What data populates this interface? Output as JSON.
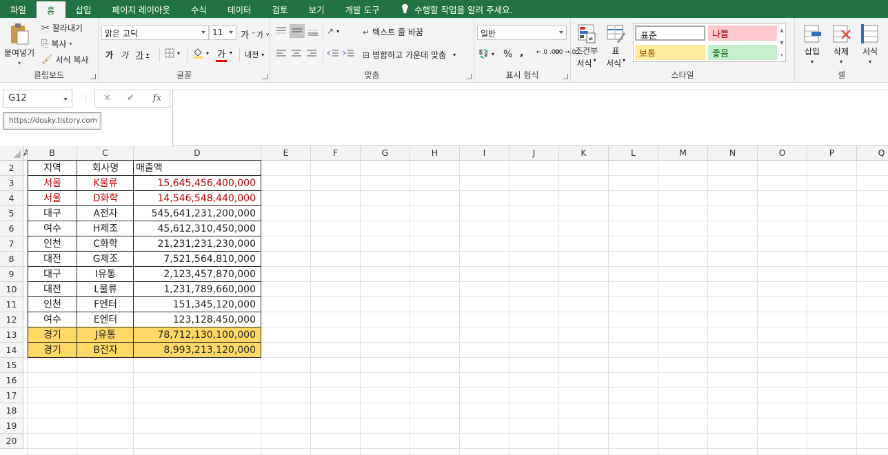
{
  "tabs": [
    "파일",
    "홈",
    "삽입",
    "페이지 레이아웃",
    "수식",
    "데이터",
    "검토",
    "보기",
    "개발 도구"
  ],
  "tell_me": "수행할 작업을 알려 주세요.",
  "ribbon": {
    "clipboard": {
      "paste": "붙여넣기",
      "cut": "잘라내기",
      "copy": "복사",
      "format_painter": "서식 복사",
      "label": "클립보드"
    },
    "font": {
      "name": "맑은 고딕",
      "size": "11",
      "grow": "가",
      "shrink": "가",
      "bold": "가",
      "italic": "가",
      "underline": "가",
      "font_color_glyph": "가",
      "phonetic": "내천",
      "label": "글꼴"
    },
    "align": {
      "wrap": "텍스트 줄 바꿈",
      "merge": "병합하고 가운데 맞춤",
      "label": "맞춤"
    },
    "number": {
      "format": "일반",
      "percent": "%",
      "comma": ",",
      "inc_dec": "←.0 .00",
      "dec_dec": ".00 →.0",
      "label": "표시 형식"
    },
    "cond": {
      "cond_fmt_1": "조건부",
      "cond_fmt_2": "서식",
      "table_1": "표",
      "table_2": "서식"
    },
    "styles": {
      "normal": "표준",
      "bad": "나쁨",
      "neutral": "보통",
      "good": "좋음",
      "label": "스타일",
      "colors": {
        "bad_bg": "#ffc7ce",
        "bad_fg": "#9c0006",
        "neutral_bg": "#ffeb9c",
        "neutral_fg": "#9c5700",
        "good_bg": "#c6efce",
        "good_fg": "#006100"
      }
    },
    "cells": {
      "insert": "삽입",
      "delete": "삭제",
      "format": "서식",
      "label": "셀"
    }
  },
  "formula_bar": {
    "name_box": "G12",
    "cancel": "✕",
    "enter": "✔",
    "fx": "fx",
    "value": ""
  },
  "tooltip": "https://dosky.tistory.com",
  "columns": [
    "A",
    "B",
    "C",
    "D",
    "E",
    "F",
    "G",
    "H",
    "I",
    "J",
    "K",
    "L",
    "M",
    "N",
    "O",
    "P",
    "Q"
  ],
  "rows": [
    "2",
    "3",
    "4",
    "5",
    "6",
    "7",
    "8",
    "9",
    "10",
    "11",
    "12",
    "13",
    "14",
    "15",
    "16",
    "17",
    "18",
    "19",
    "20"
  ],
  "table": {
    "header": [
      "지역",
      "회사명",
      "매출액"
    ],
    "rows": [
      {
        "region": "서울",
        "company": "K물류",
        "sales": "15,645,456,400,000",
        "style": "red"
      },
      {
        "region": "서울",
        "company": "D화학",
        "sales": "14,546,548,440,000",
        "style": "red"
      },
      {
        "region": "대구",
        "company": "A전자",
        "sales": "545,641,231,200,000",
        "style": "normal"
      },
      {
        "region": "여수",
        "company": "H제조",
        "sales": "45,612,310,450,000",
        "style": "normal"
      },
      {
        "region": "인천",
        "company": "C화학",
        "sales": "21,231,231,230,000",
        "style": "normal"
      },
      {
        "region": "대전",
        "company": "G제조",
        "sales": "7,521,564,810,000",
        "style": "normal"
      },
      {
        "region": "대구",
        "company": "I유통",
        "sales": "2,123,457,870,000",
        "style": "normal"
      },
      {
        "region": "대전",
        "company": "L물류",
        "sales": "1,231,789,660,000",
        "style": "normal"
      },
      {
        "region": "인천",
        "company": "F엔터",
        "sales": "151,345,120,000",
        "style": "normal"
      },
      {
        "region": "여수",
        "company": "E엔터",
        "sales": "123,128,450,000",
        "style": "normal"
      },
      {
        "region": "경기",
        "company": "J유통",
        "sales": "78,712,130,100,000",
        "style": "yellow"
      },
      {
        "region": "경기",
        "company": "B전자",
        "sales": "8,993,213,120,000",
        "style": "yellow"
      }
    ],
    "colors": {
      "red_text": "#c00000",
      "yellow_fill": "#ffd966"
    }
  },
  "accent": "#217346"
}
